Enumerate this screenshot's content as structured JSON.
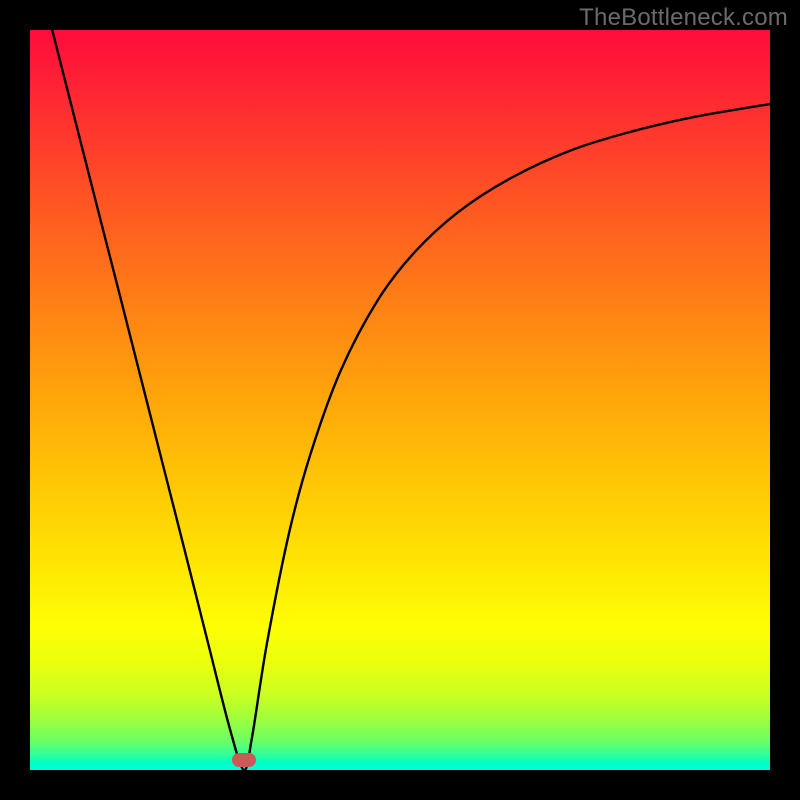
{
  "watermark": "TheBottleneck.com",
  "chart_data": {
    "type": "line",
    "title": "",
    "xlabel": "",
    "ylabel": "",
    "xlim": [
      0,
      1
    ],
    "ylim": [
      0,
      1
    ],
    "grid": false,
    "legend": false,
    "background": {
      "style": "vertical-gradient",
      "meaning": "top = high bottleneck (red), bottom = low bottleneck (green)",
      "stops": [
        {
          "pos": 0.0,
          "color": "#ff0d3a"
        },
        {
          "pos": 0.5,
          "color": "#ffa60a"
        },
        {
          "pos": 0.81,
          "color": "#fdff04"
        },
        {
          "pos": 1.0,
          "color": "#00ffd8"
        }
      ]
    },
    "series": [
      {
        "name": "bottleneck-curve",
        "color": "#000000",
        "x": [
          0.03,
          0.06,
          0.09,
          0.12,
          0.15,
          0.18,
          0.21,
          0.24,
          0.27,
          0.289,
          0.3,
          0.32,
          0.35,
          0.38,
          0.42,
          0.47,
          0.52,
          0.58,
          0.65,
          0.73,
          0.81,
          0.9,
          1.0
        ],
        "y": [
          1.0,
          0.882,
          0.764,
          0.647,
          0.529,
          0.411,
          0.293,
          0.174,
          0.056,
          0.0,
          0.044,
          0.17,
          0.32,
          0.43,
          0.54,
          0.635,
          0.7,
          0.755,
          0.8,
          0.837,
          0.862,
          0.883,
          0.9
        ]
      }
    ],
    "marker": {
      "name": "optimal-point",
      "shape": "rounded-rect",
      "x": 0.289,
      "y": 0.013,
      "color": "#c95b56"
    }
  }
}
